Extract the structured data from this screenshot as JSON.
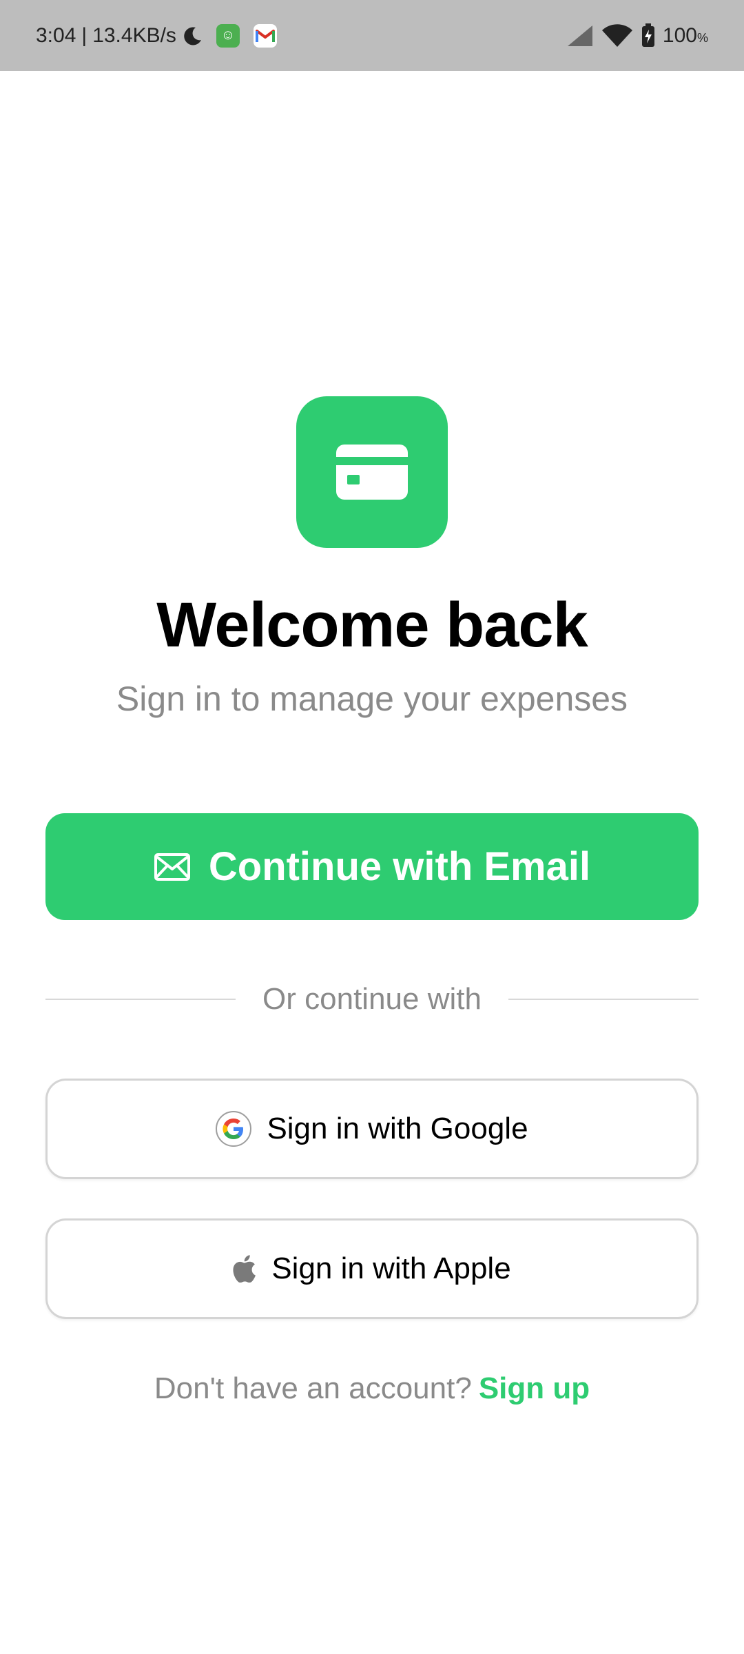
{
  "status_bar": {
    "time": "3:04",
    "separator": "|",
    "net_speed": "13.4KB/s",
    "battery": "100",
    "battery_unit": "%",
    "icons": [
      "moon-icon",
      "app-notification-icon",
      "gmail-icon",
      "signal-icon",
      "wifi-icon",
      "battery-charging-icon"
    ]
  },
  "brand": {
    "accent": "#2ecc71",
    "logo_icon": "credit-card-icon"
  },
  "header": {
    "title": "Welcome back",
    "subtitle": "Sign in to manage your expenses"
  },
  "actions": {
    "email_label": "Continue with Email",
    "email_icon": "envelope-icon",
    "divider_text": "Or continue with",
    "google_label": "Sign in with Google",
    "apple_label": "Sign in with Apple"
  },
  "footer": {
    "prompt": "Don't have an account?",
    "signup_label": "Sign up"
  }
}
